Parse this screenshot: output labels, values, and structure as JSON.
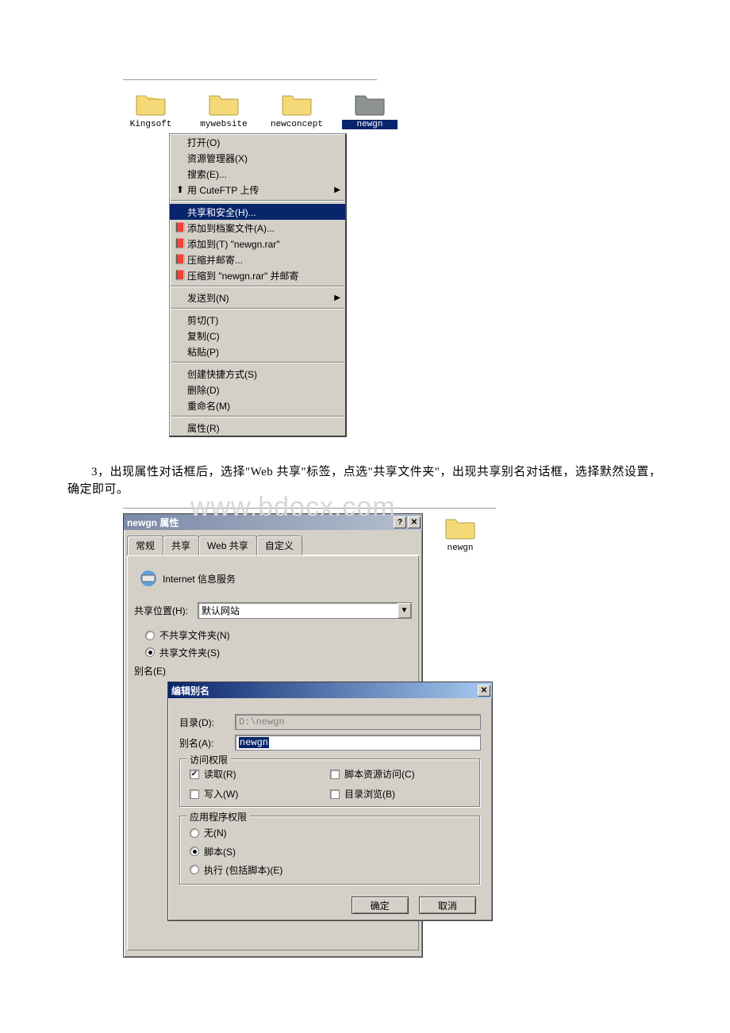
{
  "fig1": {
    "folders": [
      {
        "label": "Kingsoft"
      },
      {
        "label": "mywebsite"
      },
      {
        "label": "newconcept"
      },
      {
        "label": "newgn"
      }
    ],
    "menu": {
      "open": "打开(O)",
      "explorer": "资源管理器(X)",
      "search": "搜索(E)...",
      "cuteftp": "用 CuteFTP 上传",
      "sharing": "共享和安全(H)...",
      "addArchive": "添加到档案文件(A)...",
      "addToRar": "添加到(T) \"newgn.rar\"",
      "compressMail": "压缩并邮寄...",
      "compressToRarMail": "压缩到 \"newgn.rar\" 并邮寄",
      "sendTo": "发送到(N)",
      "cut": "剪切(T)",
      "copy": "复制(C)",
      "paste": "粘贴(P)",
      "shortcut": "创建快捷方式(S)",
      "delete": "删除(D)",
      "rename": "重命名(M)",
      "properties": "属性(R)"
    }
  },
  "paragraph": "3，出现属性对话框后，选择\"Web 共享\"标签，点选\"共享文件夹\"，出现共享别名对话框，选择默然设置，确定即可。",
  "watermark": "www.bdocx.com",
  "fig2": {
    "loneFolder": "newgn",
    "propTitle": "newgn 属性",
    "tabs": {
      "general": "常规",
      "share": "共享",
      "webShare": "Web 共享",
      "custom": "自定义"
    },
    "iisLabel": "Internet 信息服务",
    "shareLocLabel": "共享位置(H):",
    "shareLocValue": "默认网站",
    "radioNoShare": "不共享文件夹(N)",
    "radioShare": "共享文件夹(S)",
    "aliasLabel": "别名(E)",
    "editAliasTitle": "编辑别名",
    "dirLabel": "目录(D):",
    "dirValue": "D:\\newgn",
    "aliasFieldLabel": "别名(A):",
    "aliasValue": "newgn",
    "accessGroup": "访问权限",
    "chkRead": "读取(R)",
    "chkScriptSrc": "脚本资源访问(C)",
    "chkWrite": "写入(W)",
    "chkDirBrowse": "目录浏览(B)",
    "appGroup": "应用程序权限",
    "radioNone": "无(N)",
    "radioScript": "脚本(S)",
    "radioExec": "执行 (包括脚本)(E)",
    "btnOk": "确定",
    "btnCancel": "取消"
  }
}
